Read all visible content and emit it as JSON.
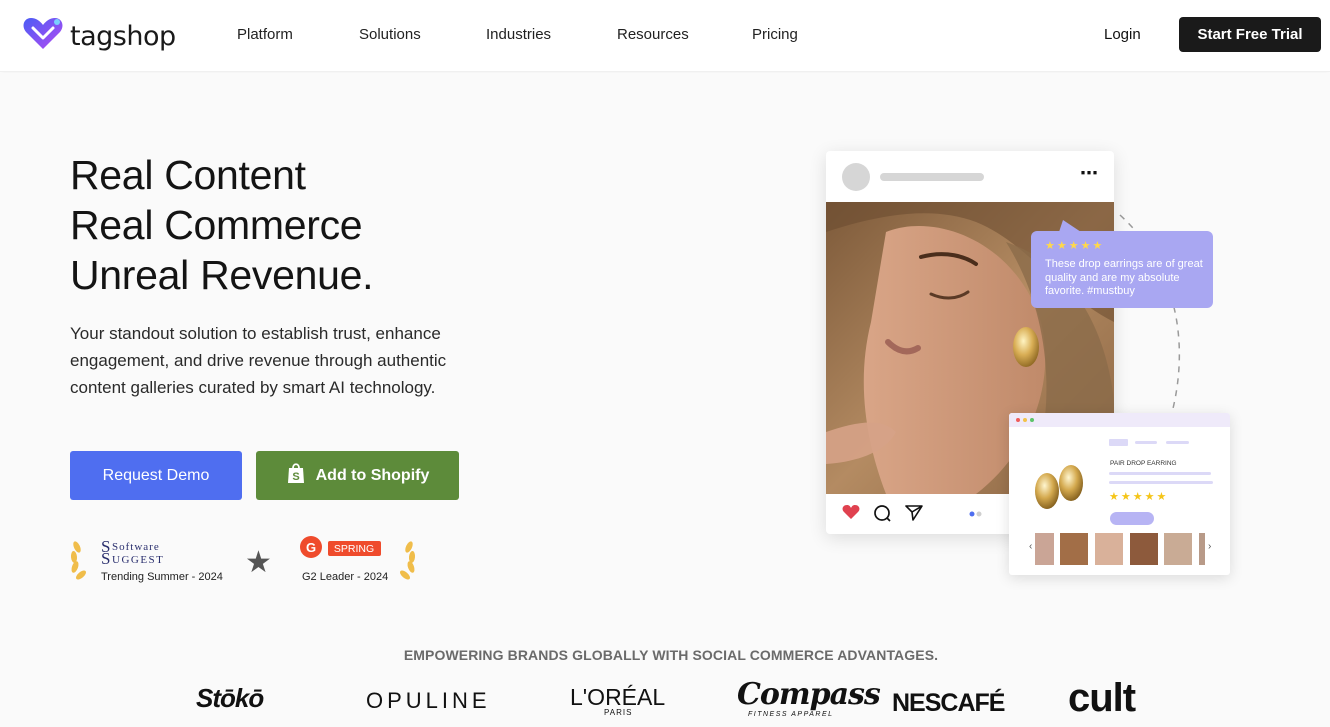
{
  "header": {
    "brand_name": "tagshop",
    "nav": [
      "Platform",
      "Solutions",
      "Industries",
      "Resources",
      "Pricing"
    ],
    "login_label": "Login",
    "trial_label": "Start Free Trial"
  },
  "hero": {
    "headline_lines": [
      "Real Content",
      "Real Commerce",
      "Unreal Revenue."
    ],
    "subtext": "Your standout solution to establish trust, enhance engagement, and drive revenue through authentic content galleries curated by smart AI technology.",
    "demo_label": "Request Demo",
    "shopify_label": "Add to Shopify"
  },
  "badges": {
    "software_suggest": {
      "name_top": "Software",
      "name_bottom": "Suggest",
      "caption": "Trending Summer - 2024"
    },
    "g2": {
      "tag": "SPRING",
      "caption": "G2 Leader - 2024"
    }
  },
  "illustration": {
    "review_text": "These drop earrings are of great quality and are my absolute favorite. #mustbuy",
    "review_rating": 5,
    "product_label": "PAIR DROP EARRING",
    "product_rating": 5
  },
  "brands": {
    "heading": "EMPOWERING BRANDS GLOBALLY WITH SOCIAL COMMERCE ADVANTAGES.",
    "logos": [
      "Stōkō",
      "OPULINE",
      "L'ORÉAL",
      "PARIS",
      "Compass",
      "FITNESS APPAREL",
      "NESCAFÉ",
      "cult"
    ]
  },
  "colors": {
    "primary_button": "#4f6ef0",
    "shopify_button": "#5d8b3a",
    "trial_button": "#1a1a1a",
    "review_bubble": "#a9a7f2",
    "logo_gradient": [
      "#4b5cf5",
      "#b34cf2"
    ]
  },
  "icons": [
    "heart-logo-icon",
    "heart-icon",
    "comment-icon",
    "share-icon",
    "more-icon",
    "shopify-bag-icon",
    "laurel-icon",
    "star-icon",
    "chevron-left-icon",
    "chevron-right-icon"
  ]
}
